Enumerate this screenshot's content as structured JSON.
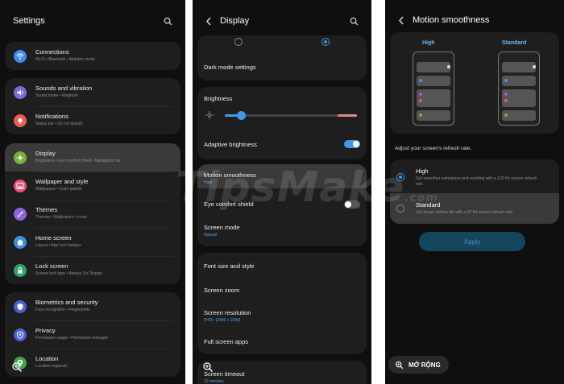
{
  "watermark": {
    "main": "TipsMake",
    "suffix": ".com"
  },
  "settings": {
    "title": "Settings",
    "groups": [
      [
        {
          "title": "Connections",
          "subtitle": "Wi-Fi  •  Bluetooth  •  Airplane mode",
          "icon": "wifi-icon",
          "color": "#3b8ff0"
        }
      ],
      [
        {
          "title": "Sounds and vibration",
          "subtitle": "Sound mode  •  Ringtone",
          "icon": "volume-icon",
          "color": "#7d6bdc"
        },
        {
          "title": "Notifications",
          "subtitle": "Status bar  •  Do not disturb",
          "icon": "bell-icon",
          "color": "#e6604b"
        }
      ],
      [
        {
          "title": "Display",
          "subtitle": "Brightness  •  Eye comfort shield  •  Navigation bar",
          "icon": "sun-icon",
          "color": "#78b13a"
        },
        {
          "title": "Wallpaper and style",
          "subtitle": "Wallpapers  •  Color palette",
          "icon": "image-icon",
          "color": "#e8517a"
        },
        {
          "title": "Themes",
          "subtitle": "Themes  •  Wallpapers  •  Icons",
          "icon": "brush-icon",
          "color": "#8e63e0"
        },
        {
          "title": "Home screen",
          "subtitle": "Layout  •  App icon badges",
          "icon": "home-icon",
          "color": "#3a8ee8"
        },
        {
          "title": "Lock screen",
          "subtitle": "Screen lock type  •  Always On Display",
          "icon": "lock-icon",
          "color": "#2fa36b"
        }
      ],
      [
        {
          "title": "Biometrics and security",
          "subtitle": "Face recognition  •  Fingerprints",
          "icon": "shield-icon",
          "color": "#4a5fd8"
        },
        {
          "title": "Privacy",
          "subtitle": "Permission usage  •  Permission manager",
          "icon": "privacy-icon",
          "color": "#4a5fd8"
        },
        {
          "title": "Location",
          "subtitle": "Location requests",
          "icon": "location-icon",
          "color": "#3fa545"
        }
      ]
    ]
  },
  "display": {
    "title": "Display",
    "dark_mode": "Dark mode settings",
    "brightness": "Brightness",
    "brightness_level": 0.12,
    "adaptive": "Adaptive brightness",
    "motion": {
      "title": "Motion smoothness",
      "value": "High"
    },
    "eye": "Eye comfort shield",
    "mode": {
      "title": "Screen mode",
      "value": "Natural"
    },
    "font": "Font size and style",
    "zoom": "Screen zoom",
    "resolution": {
      "title": "Screen resolution",
      "value": "FHD+ (2400 x 1080)"
    },
    "fullscreen": "Full screen apps",
    "timeout": {
      "title": "Screen timeout",
      "value": "10 minutes"
    }
  },
  "motion": {
    "title": "Motion smoothness",
    "label_high": "High",
    "label_standard": "Standard",
    "prompt": "Adjust your screen's refresh rate.",
    "options": [
      {
        "title": "High",
        "desc": "Get smoother animations and scrolling with a 120 Hz screen refresh rate.",
        "selected": true
      },
      {
        "title": "Standard",
        "desc": "Get longer battery life with a 60 Hz screen refresh rate.",
        "selected": false
      }
    ],
    "apply": "Apply",
    "expand": "MỞ RỘNG"
  },
  "colors": {
    "accent": "#3d9be9",
    "highlight": "#3a3a3a",
    "slider_end": "#e08a8a"
  }
}
